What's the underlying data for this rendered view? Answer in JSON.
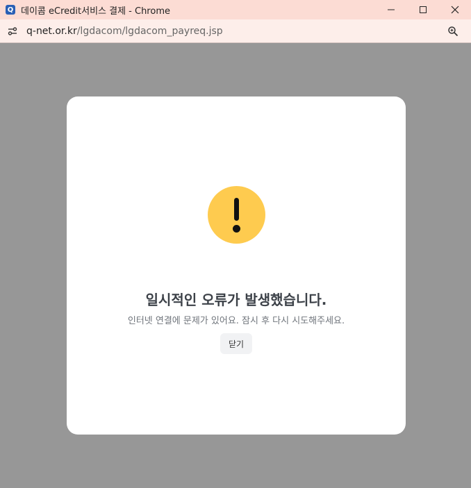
{
  "window": {
    "title": "데이콤 eCredit서비스 결제 - Chrome",
    "app_icon_glyph": "Q",
    "controls": [
      "minimize",
      "maximize",
      "close"
    ]
  },
  "addressbar": {
    "url_host": "q-net.or.kr",
    "url_path": "/lgdacom/lgdacom_payreq.jsp"
  },
  "dialog": {
    "icon": "exclamation-icon",
    "icon_color": "#fecb4f",
    "title": "일시적인 오류가 발생했습니다.",
    "message": "인터넷 연결에 문제가 있어요. 잠시 후 다시 시도해주세요.",
    "close_label": "닫기"
  }
}
